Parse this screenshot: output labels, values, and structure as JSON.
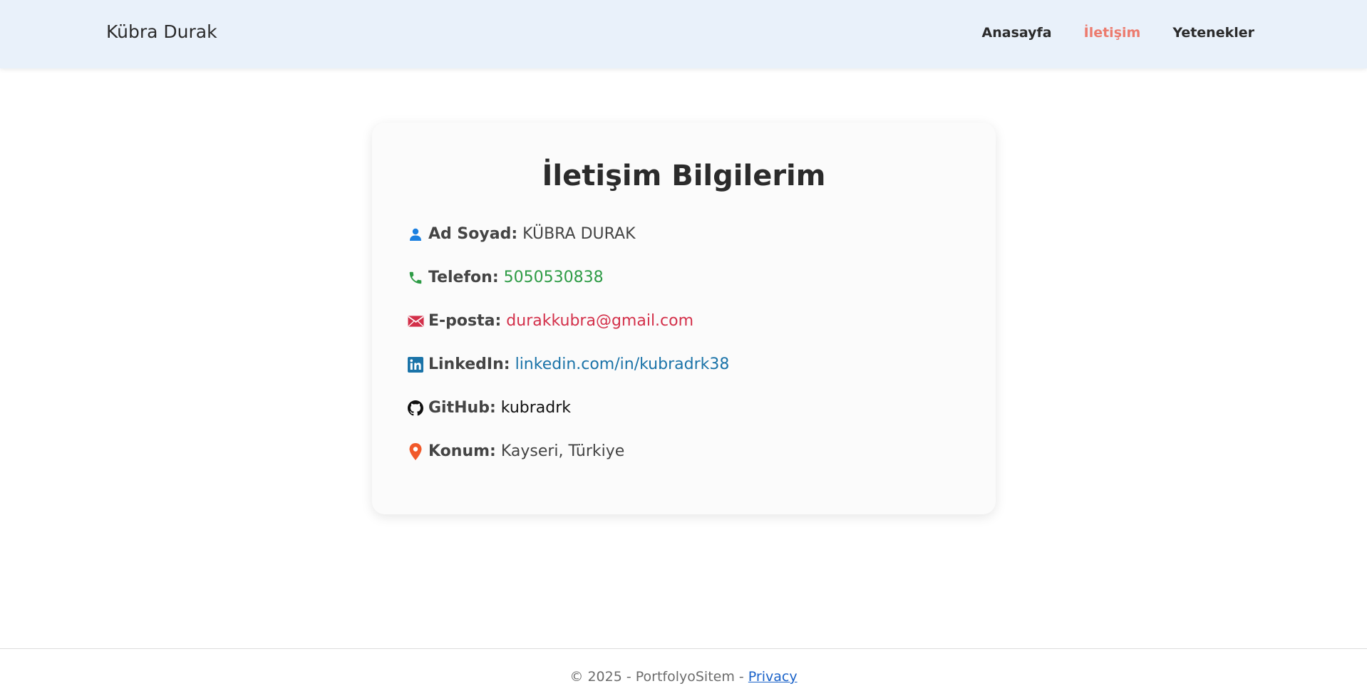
{
  "header": {
    "brand": "Kübra Durak",
    "nav": [
      {
        "label": "Anasayfa",
        "active": false
      },
      {
        "label": "İletişim",
        "active": true
      },
      {
        "label": "Yetenekler",
        "active": false
      }
    ]
  },
  "contact": {
    "title": "İletişim Bilgilerim",
    "items": [
      {
        "icon": "person-icon",
        "label": "Ad Soyad:",
        "value": "KÜBRA DURAK"
      },
      {
        "icon": "phone-icon",
        "label": "Telefon:",
        "value": "5050530838"
      },
      {
        "icon": "envelope-icon",
        "label": "E-posta:",
        "value": "durakkubra@gmail.com"
      },
      {
        "icon": "linkedin-icon",
        "label": "LinkedIn:",
        "value": "linkedin.com/in/kubradrk38"
      },
      {
        "icon": "github-icon",
        "label": "GitHub:",
        "value": "kubradrk"
      },
      {
        "icon": "location-pin-icon",
        "label": "Konum:",
        "value": "Kayseri, Türkiye"
      }
    ]
  },
  "footer": {
    "text": "© 2025 - PortfolyoSitem - ",
    "privacy_link": "Privacy"
  },
  "colors": {
    "header_bg": "#e9f1fa",
    "nav_active": "#ec7b6e",
    "phone": "#2d9b45",
    "email": "#d3304a",
    "linkedin": "#1a73a8",
    "person_icon": "#1a7fe0",
    "location_icon": "#f1592a",
    "link": "#1a62c9"
  }
}
